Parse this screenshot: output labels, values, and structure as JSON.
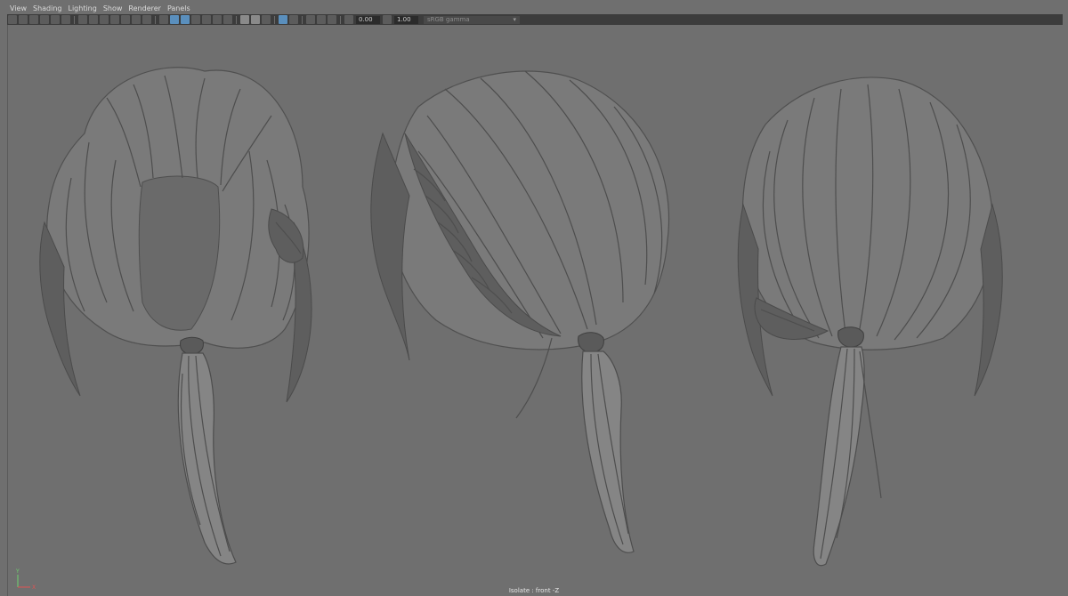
{
  "menu": {
    "items": [
      "View",
      "Shading",
      "Lighting",
      "Show",
      "Renderer",
      "Panels"
    ]
  },
  "toolbar": {
    "exposure_value": "0.00",
    "gamma_value": "1.00",
    "color_space": "sRGB gamma"
  },
  "viewport": {
    "objects": [
      "hair-model-front",
      "hair-model-side",
      "hair-model-back"
    ]
  },
  "status": {
    "text": "Isolate : front -Z"
  },
  "axis": {
    "y_label": "Y",
    "x_label": "X",
    "y_color": "#6fd36f",
    "x_color": "#e05353"
  }
}
